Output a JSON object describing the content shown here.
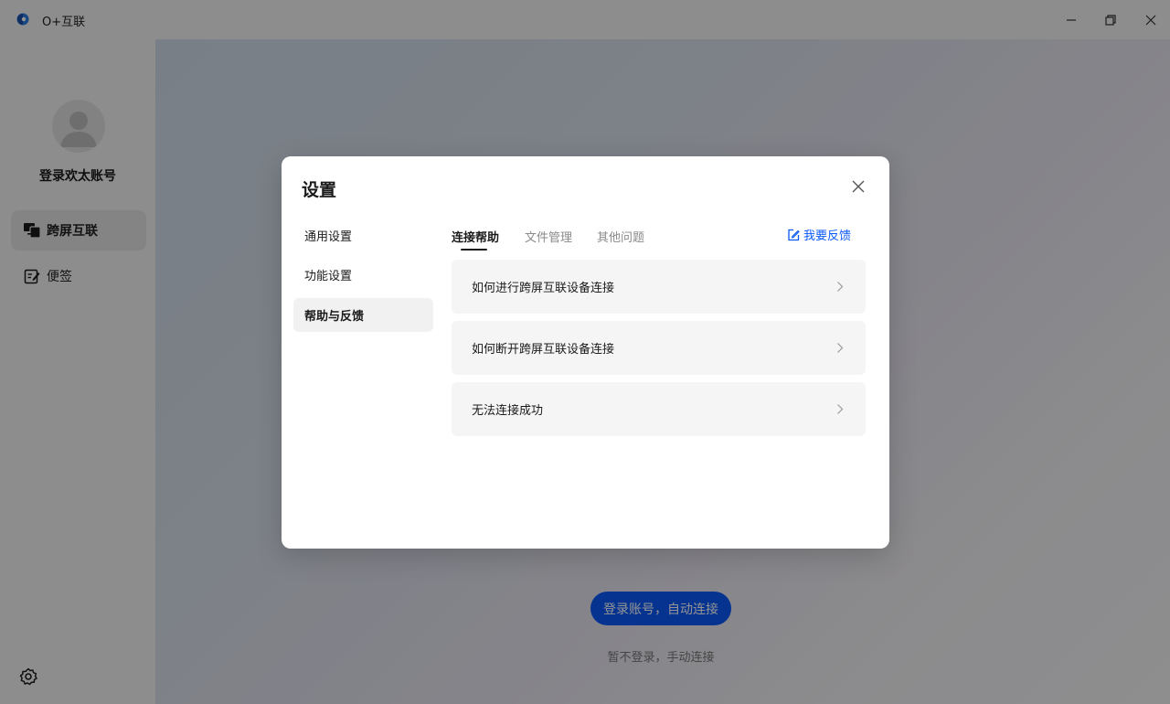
{
  "window": {
    "title": "O+互联"
  },
  "sidebar": {
    "account_name": "登录欢太账号",
    "items": [
      {
        "label": "跨屏互联",
        "icon": "screens-icon"
      },
      {
        "label": "便签",
        "icon": "note-edit-icon"
      }
    ]
  },
  "main": {
    "login_button": "登录账号，自动连接",
    "skip_link": "暂不登录，手动连接"
  },
  "dialog": {
    "title": "设置",
    "menu": [
      {
        "label": "通用设置"
      },
      {
        "label": "功能设置"
      },
      {
        "label": "帮助与反馈"
      }
    ],
    "tabs": [
      {
        "label": "连接帮助"
      },
      {
        "label": "文件管理"
      },
      {
        "label": "其他问题"
      }
    ],
    "feedback_label": "我要反馈",
    "help_items": [
      {
        "label": "如何进行跨屏互联设备连接"
      },
      {
        "label": "如何断开跨屏互联设备连接"
      },
      {
        "label": "无法连接成功"
      }
    ]
  },
  "colors": {
    "accent": "#0a59f7",
    "overlay": "rgba(0,0,0,0.42)"
  }
}
